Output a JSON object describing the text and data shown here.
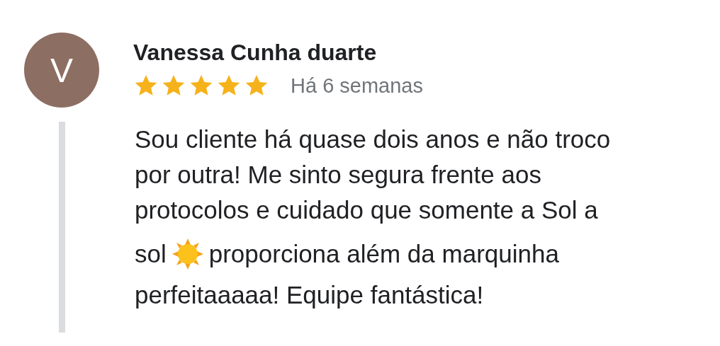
{
  "review": {
    "avatar_letter": "V",
    "author": "Vanessa Cunha duarte",
    "stars": 5,
    "time": "Há 6 semanas",
    "body_lines": [
      [
        {
          "kind": "text",
          "text": "Sou cliente há quase dois anos e não troco"
        }
      ],
      [
        {
          "kind": "text",
          "text": "por outra! Me sinto segura frente aos"
        }
      ],
      [
        {
          "kind": "text",
          "text": "protocolos e cuidado que somente a Sol a"
        }
      ],
      [
        {
          "kind": "text",
          "text": "sol"
        },
        {
          "kind": "emoji"
        },
        {
          "kind": "text",
          "text": "proporciona além da marquinha"
        }
      ],
      [
        {
          "kind": "text",
          "text": "perfeitaaaaa! Equipe fantástica!"
        }
      ]
    ]
  }
}
